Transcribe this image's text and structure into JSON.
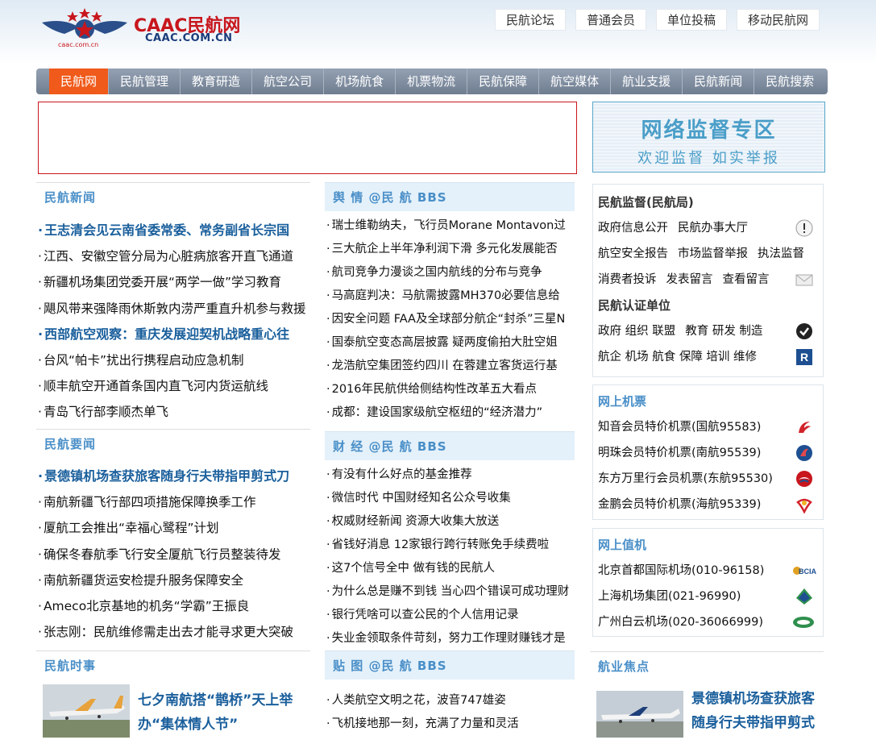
{
  "header": {
    "logo_title": "CAAC民航网",
    "logo_sub": "CAAC.COM.CN",
    "logo_small": "caac.com.cn",
    "top_links": [
      "民航论坛",
      "普通会员",
      "单位投稿",
      "移动民航网"
    ]
  },
  "nav": [
    "民航网",
    "民航管理",
    "教育研造",
    "航空公司",
    "机场航食",
    "机票物流",
    "民航保障",
    "航空媒体",
    "航业支援",
    "民航新闻",
    "民航搜索"
  ],
  "banner_right": {
    "line1": "网络监督专区",
    "line2": "欢迎监督 如实举报"
  },
  "news": {
    "title": "民航新闻",
    "items": [
      {
        "text": "王志清会见云南省委常委、常务副省长宗国",
        "bold": true
      },
      {
        "text": "江西、安徽空管分局为心脏病旅客开直飞通道",
        "bold": false
      },
      {
        "text": "新疆机场集团党委开展“两学一做”学习教育",
        "bold": false
      },
      {
        "text": "飓风带来强降雨休斯敦内涝严重直升机参与救援",
        "bold": false
      },
      {
        "text": "西部航空观察：重庆发展迎契机战略重心往",
        "bold": true
      },
      {
        "text": "台风“帕卡”扰出行携程启动应急机制",
        "bold": false
      },
      {
        "text": "顺丰航空开通首条国内直飞河内货运航线",
        "bold": false
      },
      {
        "text": "青岛飞行部李顺杰单飞",
        "bold": false
      }
    ]
  },
  "important": {
    "title": "民航要闻",
    "items": [
      {
        "text": "景德镇机场查获旅客随身行夫带指甲剪式刀",
        "bold": true
      },
      {
        "text": "南航新疆飞行部四项措施保障换季工作",
        "bold": false
      },
      {
        "text": "厦航工会推出“幸福心鹭程”计划",
        "bold": false
      },
      {
        "text": "确保冬春航季飞行安全厦航飞行员整装待发",
        "bold": false
      },
      {
        "text": "南航新疆货运安检提升服务保障安全",
        "bold": false
      },
      {
        "text": "Ameco北京基地的机务“学霸”王振良",
        "bold": false
      },
      {
        "text": "张志刚：民航维修需走出去才能寻求更大突破",
        "bold": false
      }
    ]
  },
  "events": {
    "title": "民航时事",
    "feature": "七夕南航搭“鹊桥”天上举办“集体情人节”"
  },
  "opinion": {
    "title": "舆 情 @民 航 BBS",
    "items": [
      "瑞士维勒纳夫，飞行员Morane Montavon过",
      "三大航企上半年净利润下滑 多元化发展能否",
      "航司竞争力漫谈之国内航线的分布与竞争",
      "马高庭判决：马航需披露MH370必要信息给",
      "因安全问题 FAA及全球部分航企“封杀”三星N",
      "国泰航空变态高层披露 疑两度偷拍大肚空姐",
      "龙浩航空集团签约四川 在蓉建立客货运行基",
      "2016年民航供给侧结构性改革五大看点",
      "成都：建设国家级航空枢纽的“经济潜力”"
    ]
  },
  "finance": {
    "title": "财 经 @民 航 BBS",
    "items": [
      "有没有什么好点的基金推荐",
      "微信时代 中国财经知名公众号收集",
      "权威财经新闻 资源大收集大放送",
      "省钱好消息 12家银行跨行转账免手续费啦",
      "这7个信号全中 做有钱的民航人",
      "为什么总是赚不到钱 当心四个错误可成功理财",
      "银行凭啥可以查公民的个人信用记录",
      "失业金领取条件苛刻，努力工作理财赚钱才是"
    ]
  },
  "photos": {
    "title": "贴 图 @民 航 BBS",
    "items": [
      "人类航空文明之花，波音747雄姿",
      "飞机接地那一刻，充满了力量和灵活"
    ]
  },
  "supervision": {
    "title": "民航监督(民航局)",
    "rows": [
      {
        "links": [
          "政府信息公开",
          "民航办事大厅"
        ],
        "icon": "exclamation-icon"
      },
      {
        "links": [
          "航空安全报告",
          "市场监督举报",
          "执法监督"
        ],
        "icon": ""
      },
      {
        "links": [
          "消费者投诉",
          "发表留言",
          "查看留言"
        ],
        "icon": "envelope-icon"
      }
    ],
    "cert_title": "民航认证单位",
    "cert_rows": [
      {
        "links": [
          "政府 组织 联盟",
          "教育 研发 制造"
        ],
        "icon": "check-badge-icon"
      },
      {
        "links": [
          "航企 机场 航食 保障 培训 维修"
        ],
        "icon": "r-badge-icon"
      }
    ]
  },
  "tickets": {
    "title": "网上机票",
    "items": [
      {
        "text": "知音会员特价机票(国航95583)",
        "icon": "air-china-icon",
        "color": "#d2232a"
      },
      {
        "text": "明珠会员特价机票(南航95539)",
        "icon": "china-southern-icon",
        "color": "#1d4f91"
      },
      {
        "text": "东方万里行会员机票(东航95530)",
        "icon": "china-eastern-icon",
        "color": "#c8161d"
      },
      {
        "text": "金鹏会员特价机票(海航95339)",
        "icon": "hainan-airlines-icon",
        "color": "#d2232a"
      }
    ]
  },
  "airports": {
    "title": "网上值机",
    "items": [
      {
        "text": "北京首都国际机场(010-96158)",
        "icon": "bcia-icon",
        "label": "BCIA"
      },
      {
        "text": "上海机场集团(021-96990)",
        "icon": "shanghai-airport-icon",
        "label": ""
      },
      {
        "text": "广州白云机场(020-36066999)",
        "icon": "guangzhou-airport-icon",
        "label": ""
      }
    ]
  },
  "focus": {
    "title": "航业焦点",
    "feature": "景德镇机场查获旅客随身行夫带指甲剪式"
  }
}
